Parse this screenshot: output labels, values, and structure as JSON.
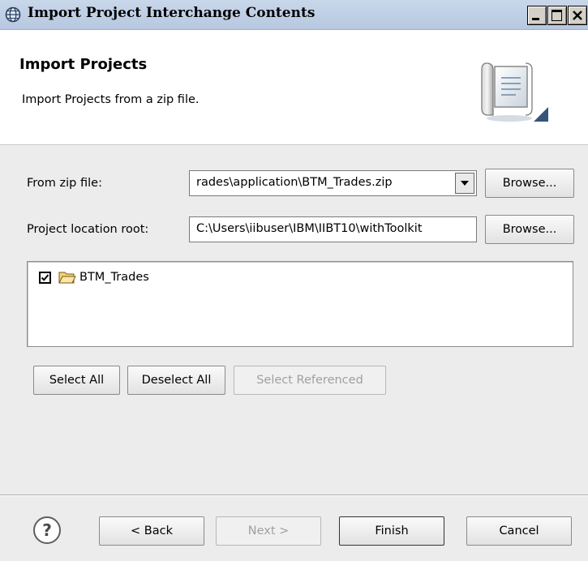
{
  "window": {
    "title": "Import Project Interchange Contents",
    "controls": {
      "minimize": "_",
      "maximize": "□",
      "close": "X"
    }
  },
  "header": {
    "title": "Import Projects",
    "description": "Import Projects from a zip file.",
    "icon": "import-wizard-icon"
  },
  "form": {
    "zip_label": "From zip file:",
    "zip_value": "rades\\application\\BTM_Trades.zip",
    "zip_browse": "Browse...",
    "root_label": "Project location root:",
    "root_value": "C:\\Users\\iibuser\\IBM\\IIBT10\\withToolkit",
    "root_browse": "Browse..."
  },
  "projects": [
    {
      "name": "BTM_Trades",
      "checked": true,
      "icon": "folder-icon"
    }
  ],
  "selection_buttons": {
    "select_all": "Select All",
    "deselect_all": "Deselect All",
    "select_referenced": "Select Referenced"
  },
  "footer": {
    "help": "?",
    "back": "< Back",
    "next": "Next >",
    "finish": "Finish",
    "cancel": "Cancel"
  }
}
